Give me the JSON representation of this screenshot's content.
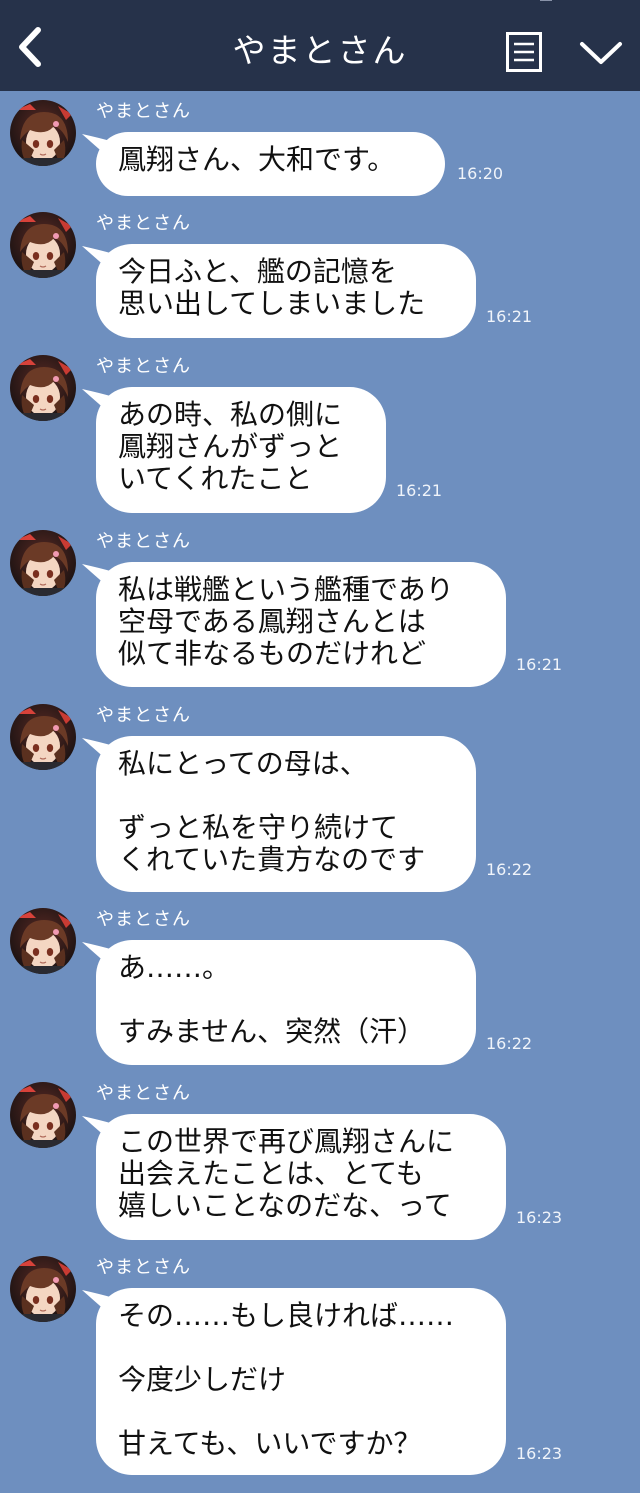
{
  "header": {
    "title": "やまとさん"
  },
  "colors": {
    "header_bg": "#26324a",
    "chat_bg": "#6e8fbf",
    "bubble_bg": "#ffffff"
  },
  "icons": {
    "back": "chevron-left-icon",
    "menu": "menu-list-icon",
    "collapse": "chevron-down-icon",
    "avatar": "avatar"
  },
  "messages": [
    {
      "sender": "やまとさん",
      "lines": [
        "鳳翔さん、大和です。"
      ],
      "time": "16:20"
    },
    {
      "sender": "やまとさん",
      "lines": [
        "今日ふと、艦の記憶を",
        "思い出してしまいました"
      ],
      "time": "16:21"
    },
    {
      "sender": "やまとさん",
      "lines": [
        "あの時、私の側に",
        "鳳翔さんがずっと",
        "いてくれたこと"
      ],
      "time": "16:21"
    },
    {
      "sender": "やまとさん",
      "lines": [
        "私は戦艦という艦種であり",
        "空母である鳳翔さんとは",
        "似て非なるものだけれど"
      ],
      "time": "16:21"
    },
    {
      "sender": "やまとさん",
      "lines": [
        "私にとっての母は、",
        "",
        "ずっと私を守り続けて",
        "くれていた貴方なのです"
      ],
      "time": "16:22"
    },
    {
      "sender": "やまとさん",
      "lines": [
        "あ……。",
        "",
        "すみません、突然（汗）"
      ],
      "time": "16:22"
    },
    {
      "sender": "やまとさん",
      "lines": [
        "この世界で再び鳳翔さんに",
        "出会えたことは、とても",
        "嬉しいことなのだな、って"
      ],
      "time": "16:23"
    },
    {
      "sender": "やまとさん",
      "lines": [
        "その……もし良ければ……",
        "",
        "今度少しだけ",
        "",
        "甘えても、いいですか？"
      ],
      "time": "16:23"
    }
  ]
}
